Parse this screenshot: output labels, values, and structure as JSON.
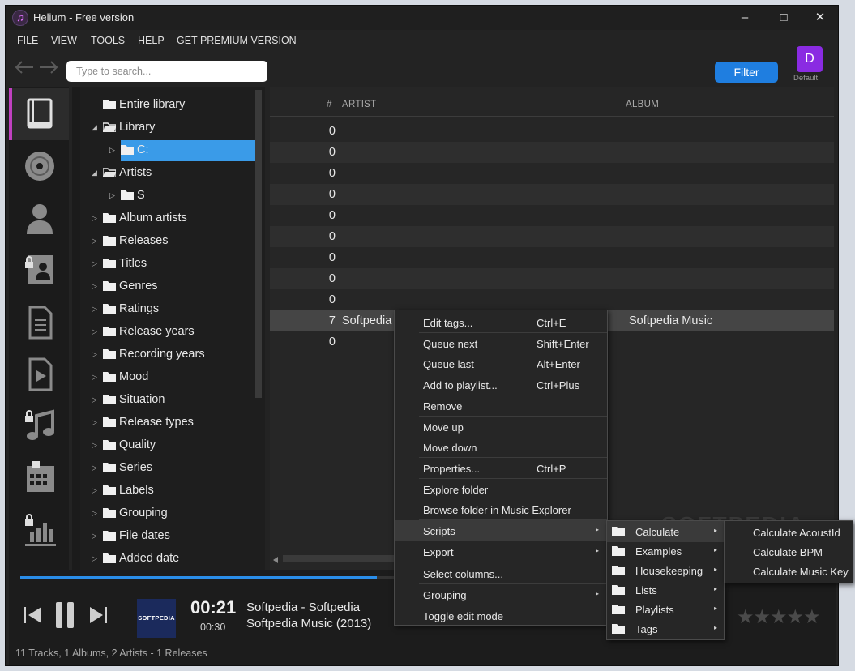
{
  "window": {
    "title": "Helium - Free version",
    "minimize": "–",
    "maximize": "□",
    "close": "✕",
    "app_icon": "♫"
  },
  "menu": [
    "FILE",
    "VIEW",
    "TOOLS",
    "HELP",
    "GET PREMIUM VERSION"
  ],
  "toolbar": {
    "search_placeholder": "Type to search...",
    "filter_label": "Filter",
    "profile_initial": "D",
    "profile_label": "Default",
    "back_icon": "arrow-left-icon",
    "forward_icon": "arrow-right-icon"
  },
  "rail_icons": [
    "book-icon",
    "disc-icon",
    "user-icon",
    "contact-lock-icon",
    "document-icon",
    "video-icon",
    "music-lock-icon",
    "calendar-lock-icon",
    "chart-lock-icon"
  ],
  "tree": [
    {
      "label": "Entire library",
      "expander": ""
    },
    {
      "label": "Library",
      "expander": "◢",
      "open": true
    },
    {
      "label": "C:",
      "expander": "▷",
      "selected": true
    },
    {
      "label": "Artists",
      "expander": "◢",
      "open": true
    },
    {
      "label": "S",
      "expander": "▷"
    },
    {
      "label": "Album artists",
      "expander": "▷"
    },
    {
      "label": "Releases",
      "expander": "▷"
    },
    {
      "label": "Titles",
      "expander": "▷"
    },
    {
      "label": "Genres",
      "expander": "▷"
    },
    {
      "label": "Ratings",
      "expander": "▷"
    },
    {
      "label": "Release years",
      "expander": "▷"
    },
    {
      "label": "Recording years",
      "expander": "▷"
    },
    {
      "label": "Mood",
      "expander": "▷"
    },
    {
      "label": "Situation",
      "expander": "▷"
    },
    {
      "label": "Release types",
      "expander": "▷"
    },
    {
      "label": "Quality",
      "expander": "▷"
    },
    {
      "label": "Series",
      "expander": "▷"
    },
    {
      "label": "Labels",
      "expander": "▷"
    },
    {
      "label": "Grouping",
      "expander": "▷"
    },
    {
      "label": "File dates",
      "expander": "▷"
    },
    {
      "label": "Added date",
      "expander": "▷"
    }
  ],
  "columns": {
    "num": "#",
    "artist": "ARTIST",
    "album": "ALBUM"
  },
  "tracks": [
    {
      "num": "0",
      "artist": "",
      "album": ""
    },
    {
      "num": "0",
      "artist": "",
      "album": ""
    },
    {
      "num": "0",
      "artist": "",
      "album": ""
    },
    {
      "num": "0",
      "artist": "",
      "album": ""
    },
    {
      "num": "0",
      "artist": "",
      "album": ""
    },
    {
      "num": "0",
      "artist": "",
      "album": ""
    },
    {
      "num": "0",
      "artist": "",
      "album": ""
    },
    {
      "num": "0",
      "artist": "",
      "album": ""
    },
    {
      "num": "0",
      "artist": "",
      "album": ""
    },
    {
      "num": "7",
      "artist": "Softpedia",
      "album": "Softpedia Music",
      "highlighted": true
    },
    {
      "num": "0",
      "artist": "",
      "album": ""
    }
  ],
  "context_menu": [
    {
      "label": "Edit tags...",
      "shortcut": "Ctrl+E"
    },
    {
      "label": "Queue next",
      "shortcut": "Shift+Enter"
    },
    {
      "label": "Queue last",
      "shortcut": "Alt+Enter"
    },
    {
      "label": "Add to playlist...",
      "shortcut": "Ctrl+Plus"
    },
    {
      "label": "Remove",
      "shortcut": ""
    },
    {
      "label": "Move up",
      "shortcut": ""
    },
    {
      "label": "Move down",
      "shortcut": ""
    },
    {
      "label": "Properties...",
      "shortcut": "Ctrl+P"
    },
    {
      "label": "Explore folder",
      "shortcut": ""
    },
    {
      "label": "Browse folder in Music Explorer",
      "shortcut": ""
    },
    {
      "label": "Scripts",
      "shortcut": "",
      "submenu": true,
      "hover": true
    },
    {
      "label": "Export",
      "shortcut": "",
      "submenu": true
    },
    {
      "label": "Select columns...",
      "shortcut": ""
    },
    {
      "label": "Grouping",
      "shortcut": "",
      "submenu": true
    },
    {
      "label": "Toggle edit mode",
      "shortcut": ""
    }
  ],
  "scripts_submenu": [
    {
      "label": "Calculate",
      "hover": true
    },
    {
      "label": "Examples"
    },
    {
      "label": "Housekeeping"
    },
    {
      "label": "Lists"
    },
    {
      "label": "Playlists"
    },
    {
      "label": "Tags"
    }
  ],
  "calculate_submenu": [
    "Calculate AcoustId",
    "Calculate BPM",
    "Calculate Music Key"
  ],
  "player": {
    "elapsed": "00:21",
    "duration": "00:30",
    "line1": "Softpedia - Softpedia",
    "line2": "Softpedia Music (2013)",
    "cover_text": "SOFTPEDIA",
    "progress": 0.44,
    "rating_stars": "★★★★★",
    "prev_icon": "skip-back-icon",
    "pause_icon": "pause-icon",
    "next_icon": "skip-forward-icon"
  },
  "status": "11 Tracks, 1 Albums, 2 Artists - 1 Releases",
  "watermark": "SOFTPEDIA",
  "colors": {
    "accent": "#1f7ee0",
    "selection": "#3a9be8",
    "rail_active": "#c040c0",
    "profile": "#8a2be2"
  }
}
